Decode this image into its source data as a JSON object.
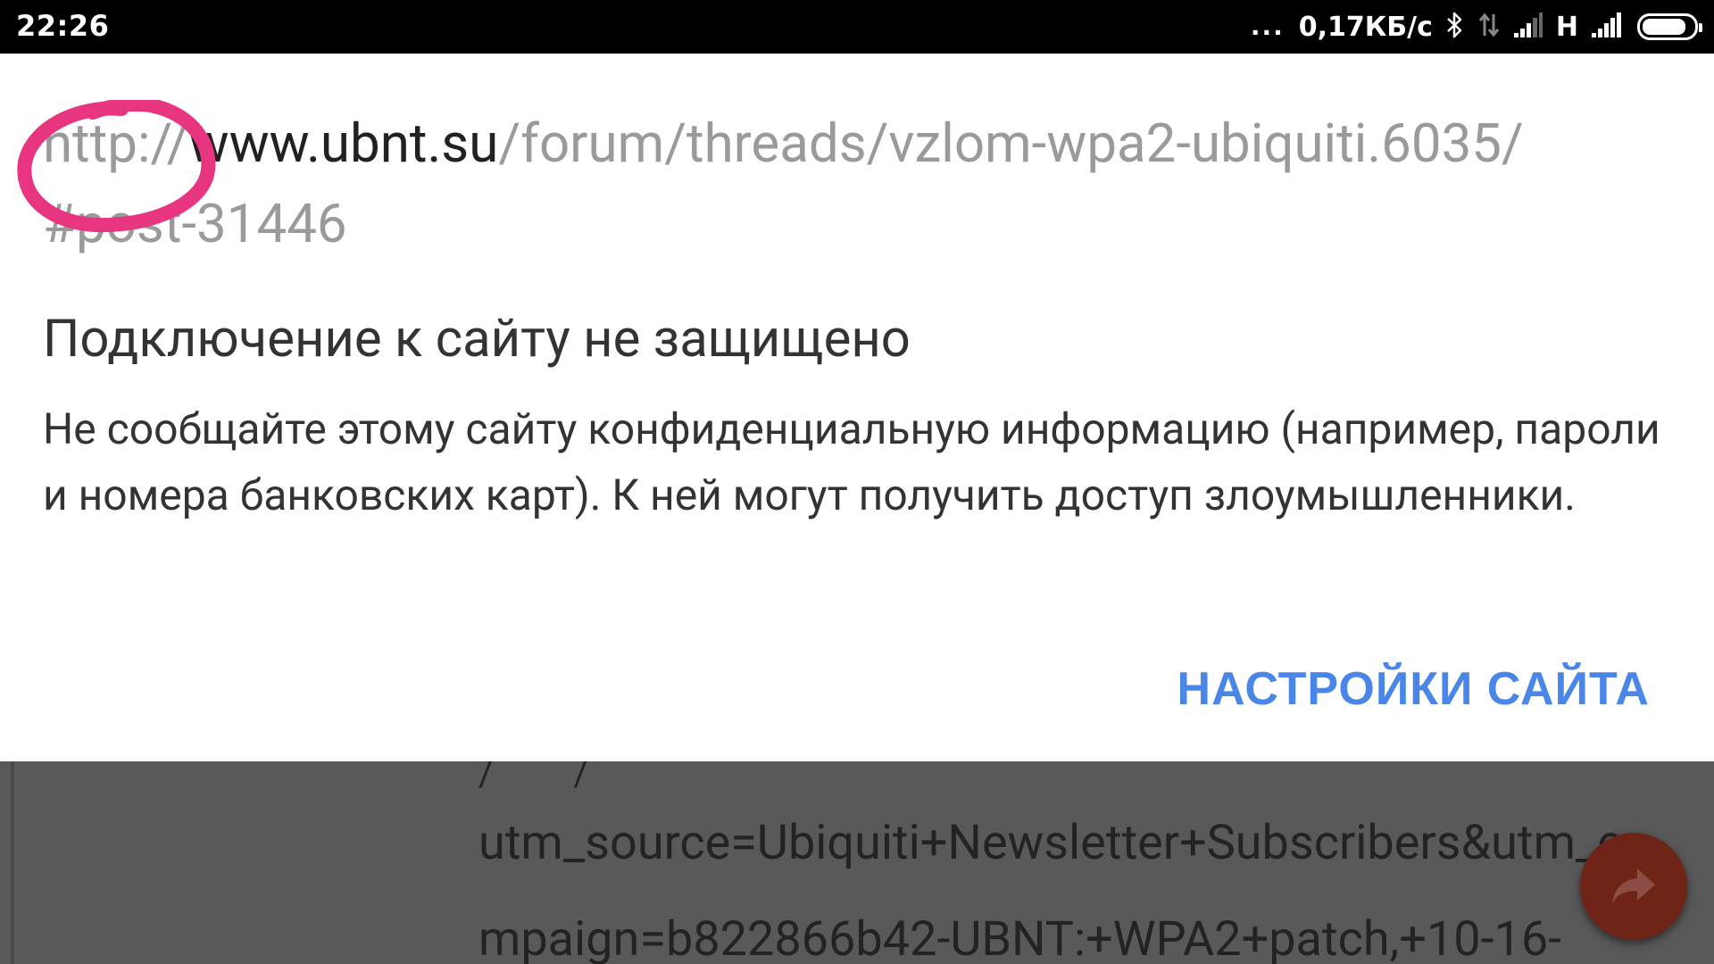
{
  "status_bar": {
    "time": "22:26",
    "more": "...",
    "network_speed": "0,17КБ/с",
    "network_type": "H",
    "icons": [
      "bluetooth-icon",
      "data-arrows-icon",
      "signal-icon",
      "signal-icon",
      "battery-icon"
    ]
  },
  "popup": {
    "url": {
      "scheme": "http://",
      "host": "www.ubnt.su",
      "path": "/forum/threads/vzlom-wpa2-ubiquiti.6035/",
      "fragment": "#post-31446"
    },
    "heading": "Подключение к сайту не защищено",
    "description": "Не сообщайте этому сайту конфиденциальную информацию (например, пароли и номера банковских карт). К ней могут получить доступ злоумышленники.",
    "site_settings_label": "НАСТРОЙКИ САЙТА"
  },
  "background_page": {
    "partial_line": "/   /",
    "line1": "utm_source=Ubiquiti+Newsletter+Subscribers&utm_c",
    "line2": "mpaign=b822866b42-UBNT:+WPA2+patch,+10-16-"
  },
  "colors": {
    "annotation_circle": "#e8357f",
    "link_blue": "#4a86e8",
    "fab": "#6e2417"
  }
}
